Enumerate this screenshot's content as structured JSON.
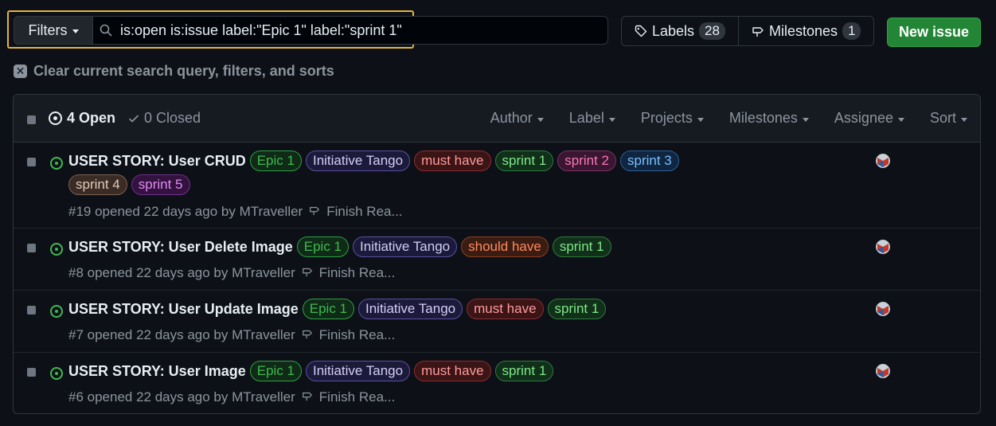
{
  "toolbar": {
    "filters_label": "Filters",
    "search_value": "is:open is:issue label:\"Epic 1\" label:\"sprint 1\"",
    "labels_label": "Labels",
    "labels_count": "28",
    "milestones_label": "Milestones",
    "milestones_count": "1",
    "new_issue_label": "New issue"
  },
  "clear_text": "Clear current search query, filters, and sorts",
  "header": {
    "open_label": "4 Open",
    "closed_label": "0 Closed",
    "filters": [
      "Author",
      "Label",
      "Projects",
      "Milestones",
      "Assignee",
      "Sort"
    ]
  },
  "issues": [
    {
      "title": "USER STORY: User CRUD",
      "labels": [
        "Epic 1",
        "Initiative Tango",
        "must have",
        "sprint 1",
        "sprint 2",
        "sprint 3",
        "sprint 4",
        "sprint 5"
      ],
      "meta": "#19 opened 22 days ago by MTraveller",
      "milestone": "Finish Rea..."
    },
    {
      "title": "USER STORY: User Delete Image",
      "labels": [
        "Epic 1",
        "Initiative Tango",
        "should have",
        "sprint 1"
      ],
      "meta": "#8 opened 22 days ago by MTraveller",
      "milestone": "Finish Rea..."
    },
    {
      "title": "USER STORY: User Update Image",
      "labels": [
        "Epic 1",
        "Initiative Tango",
        "must have",
        "sprint 1"
      ],
      "meta": "#7 opened 22 days ago by MTraveller",
      "milestone": "Finish Rea..."
    },
    {
      "title": "USER STORY: User Image",
      "labels": [
        "Epic 1",
        "Initiative Tango",
        "must have",
        "sprint 1"
      ],
      "meta": "#6 opened 22 days ago by MTraveller",
      "milestone": "Finish Rea..."
    }
  ],
  "label_colors": {
    "Epic 1": {
      "fg": "#3fb950",
      "bg": "#0f2a16",
      "border": "#2ea043"
    },
    "Initiative Tango": {
      "fg": "#d2cdf5",
      "bg": "#1c1a3a",
      "border": "#5a4fa0"
    },
    "must have": {
      "fg": "#ff9a9a",
      "bg": "#3b1416",
      "border": "#8a2c30"
    },
    "should have": {
      "fg": "#ff8a5c",
      "bg": "#3a1c12",
      "border": "#8a3f22"
    },
    "sprint 1": {
      "fg": "#7ee787",
      "bg": "#10301a",
      "border": "#2f7a3c"
    },
    "sprint 2": {
      "fg": "#f778ba",
      "bg": "#3a1630",
      "border": "#7a3066"
    },
    "sprint 3": {
      "fg": "#79c0ff",
      "bg": "#0f2540",
      "border": "#2a5f94"
    },
    "sprint 4": {
      "fg": "#e0c9b8",
      "bg": "#3a2c25",
      "border": "#7a5f4f"
    },
    "sprint 5": {
      "fg": "#e08cf0",
      "bg": "#331240",
      "border": "#6e2f8a"
    }
  },
  "icons": {
    "search": "search-icon",
    "tag": "tag-icon",
    "milestone": "milestone-icon",
    "close": "close-icon",
    "issue_open": "issue-open-icon",
    "check": "check-icon"
  },
  "colors": {
    "accent_green": "#238636",
    "highlight_border": "#e3b341",
    "open_green": "#3fb950"
  }
}
